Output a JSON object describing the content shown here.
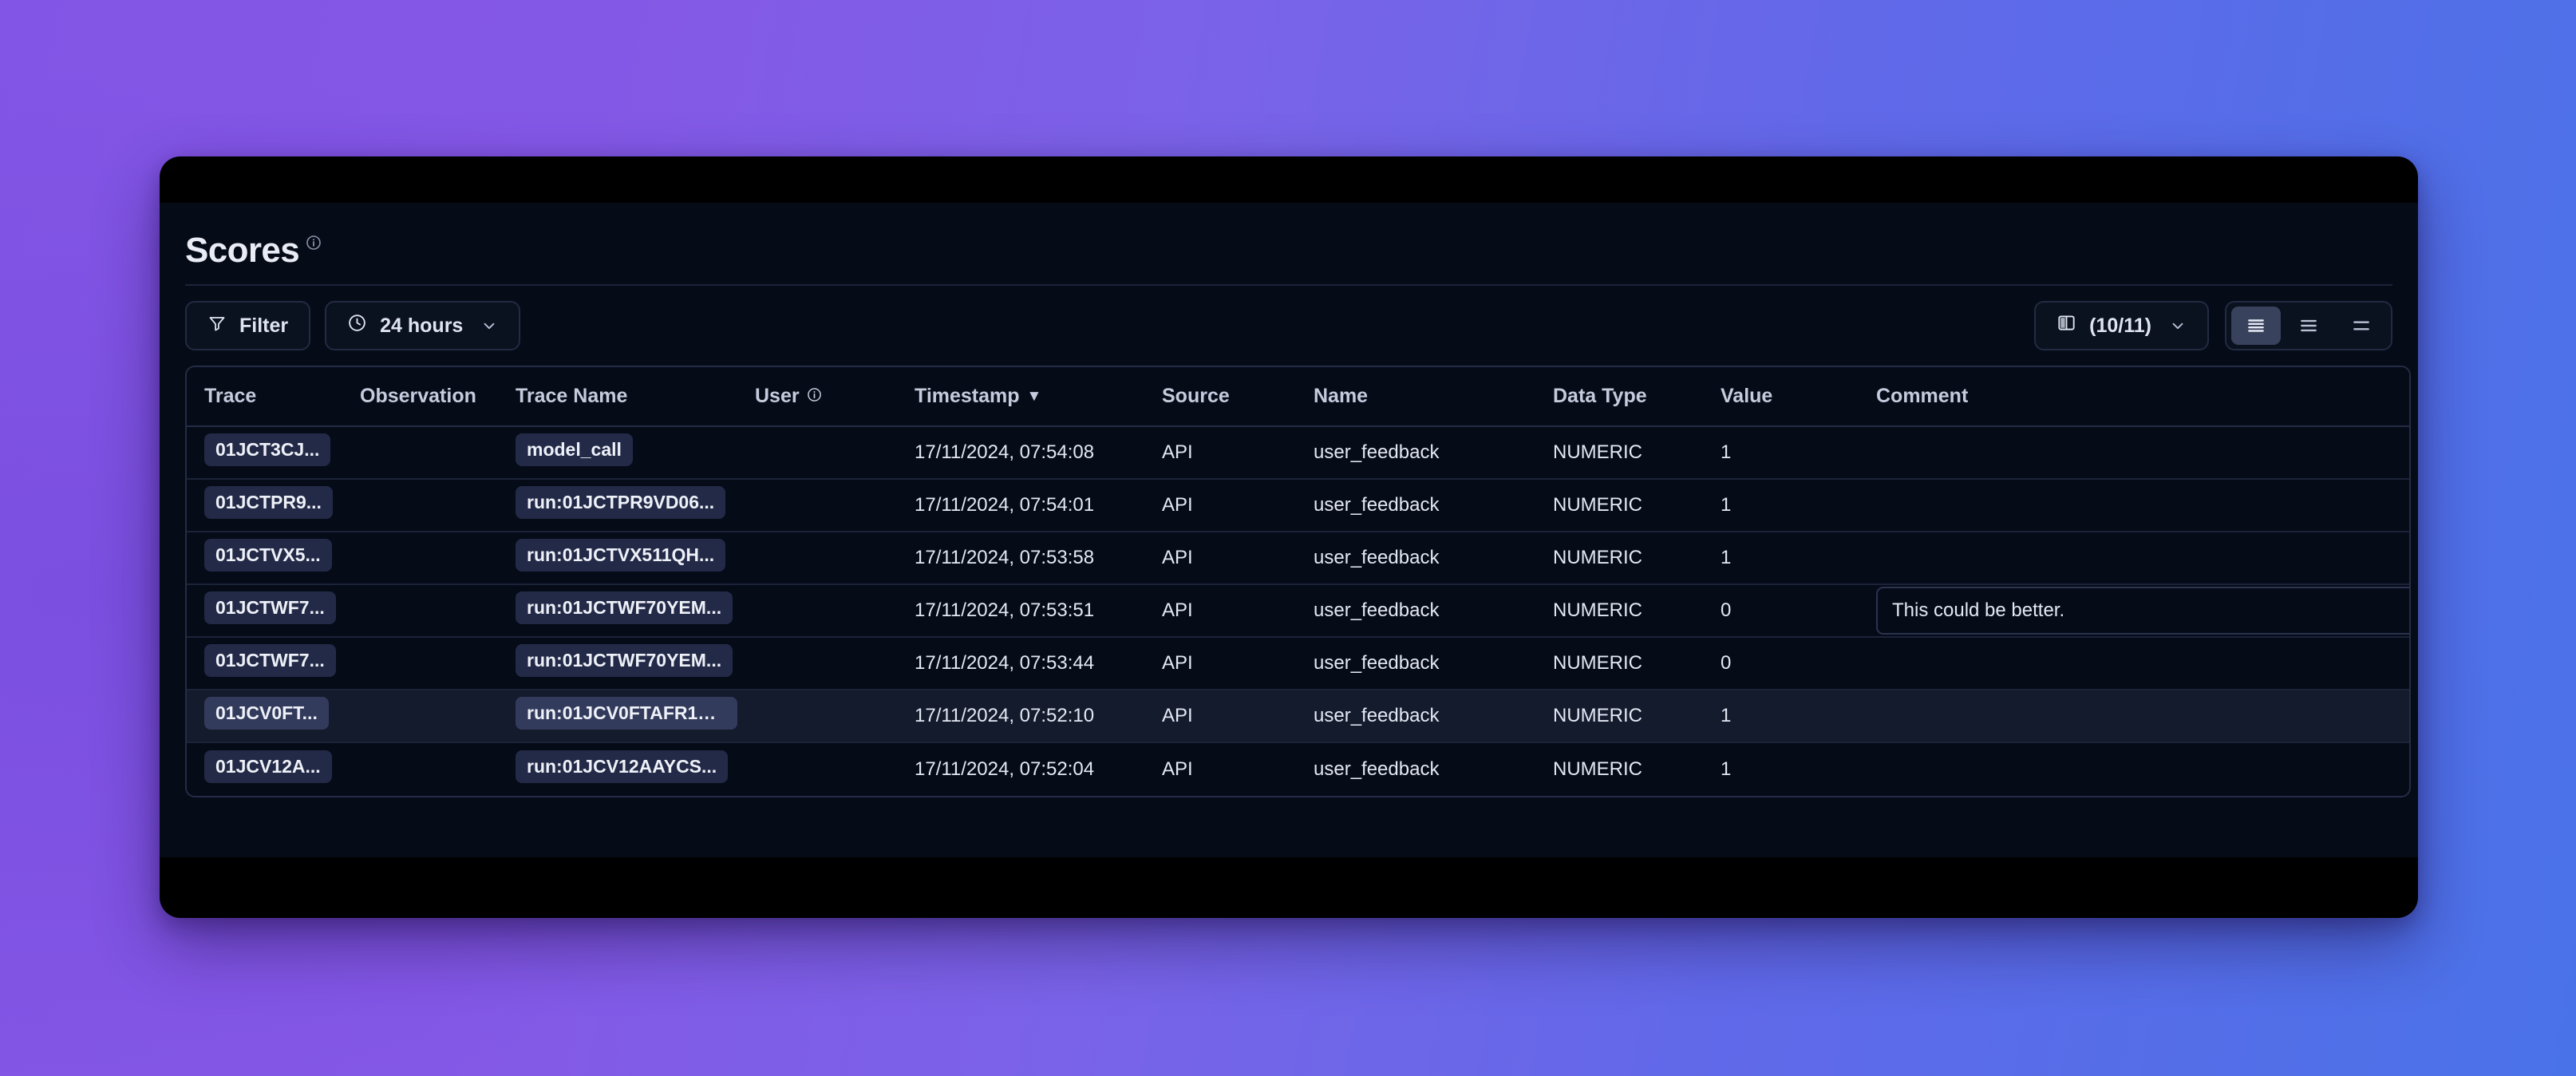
{
  "window": {
    "background_from": "#8355e6",
    "background_to": "#4a72e8",
    "panel_bg": "#060b18"
  },
  "header": {
    "title": "Scores",
    "info_icon": "info-circle-icon"
  },
  "toolbar": {
    "filter": {
      "label": "Filter",
      "icon": "funnel-icon"
    },
    "time_range": {
      "label": "24 hours",
      "icon": "clock-icon",
      "chevron": "chevron-down-icon"
    },
    "columns": {
      "label": "(10/11)",
      "icon": "columns-icon",
      "chevron": "chevron-down-icon"
    },
    "row_height": {
      "options": [
        "rows-dense-icon",
        "rows-medium-icon",
        "rows-comfortable-icon"
      ],
      "selected_index": 0
    }
  },
  "table": {
    "columns": [
      {
        "key": "trace",
        "label": "Trace",
        "icon": null
      },
      {
        "key": "observation",
        "label": "Observation",
        "icon": null
      },
      {
        "key": "trace_name",
        "label": "Trace Name",
        "icon": null
      },
      {
        "key": "user",
        "label": "User",
        "icon": "info-circle-icon"
      },
      {
        "key": "timestamp",
        "label": "Timestamp",
        "icon": "sort-desc-icon"
      },
      {
        "key": "source",
        "label": "Source",
        "icon": null
      },
      {
        "key": "name",
        "label": "Name",
        "icon": null
      },
      {
        "key": "data_type",
        "label": "Data Type",
        "icon": null
      },
      {
        "key": "value",
        "label": "Value",
        "icon": null
      },
      {
        "key": "comment",
        "label": "Comment",
        "icon": null
      }
    ],
    "sort": {
      "column": "timestamp",
      "direction": "desc",
      "caret": "▼"
    },
    "rows": [
      {
        "trace": "01JCT3CJ...",
        "observation": "",
        "trace_name": "model_call",
        "user": "",
        "timestamp": "17/11/2024, 07:54:08",
        "source": "API",
        "name": "user_feedback",
        "data_type": "NUMERIC",
        "value": "1",
        "comment": "",
        "hovered": false
      },
      {
        "trace": "01JCTPR9...",
        "observation": "",
        "trace_name": "run:01JCTPR9VD06...",
        "user": "",
        "timestamp": "17/11/2024, 07:54:01",
        "source": "API",
        "name": "user_feedback",
        "data_type": "NUMERIC",
        "value": "1",
        "comment": "",
        "hovered": false
      },
      {
        "trace": "01JCTVX5...",
        "observation": "",
        "trace_name": "run:01JCTVX511QH...",
        "user": "",
        "timestamp": "17/11/2024, 07:53:58",
        "source": "API",
        "name": "user_feedback",
        "data_type": "NUMERIC",
        "value": "1",
        "comment": "",
        "hovered": false
      },
      {
        "trace": "01JCTWF7...",
        "observation": "",
        "trace_name": "run:01JCTWF70YEM...",
        "user": "",
        "timestamp": "17/11/2024, 07:53:51",
        "source": "API",
        "name": "user_feedback",
        "data_type": "NUMERIC",
        "value": "0",
        "comment": "This could be better.",
        "hovered": false
      },
      {
        "trace": "01JCTWF7...",
        "observation": "",
        "trace_name": "run:01JCTWF70YEM...",
        "user": "",
        "timestamp": "17/11/2024, 07:53:44",
        "source": "API",
        "name": "user_feedback",
        "data_type": "NUMERIC",
        "value": "0",
        "comment": "",
        "hovered": false
      },
      {
        "trace": "01JCV0FT...",
        "observation": "",
        "trace_name": "run:01JCV0FTAFR1H...",
        "user": "",
        "timestamp": "17/11/2024, 07:52:10",
        "source": "API",
        "name": "user_feedback",
        "data_type": "NUMERIC",
        "value": "1",
        "comment": "",
        "hovered": true
      },
      {
        "trace": "01JCV12A...",
        "observation": "",
        "trace_name": "run:01JCV12AAYCS...",
        "user": "",
        "timestamp": "17/11/2024, 07:52:04",
        "source": "API",
        "name": "user_feedback",
        "data_type": "NUMERIC",
        "value": "1",
        "comment": "",
        "hovered": false
      }
    ]
  }
}
